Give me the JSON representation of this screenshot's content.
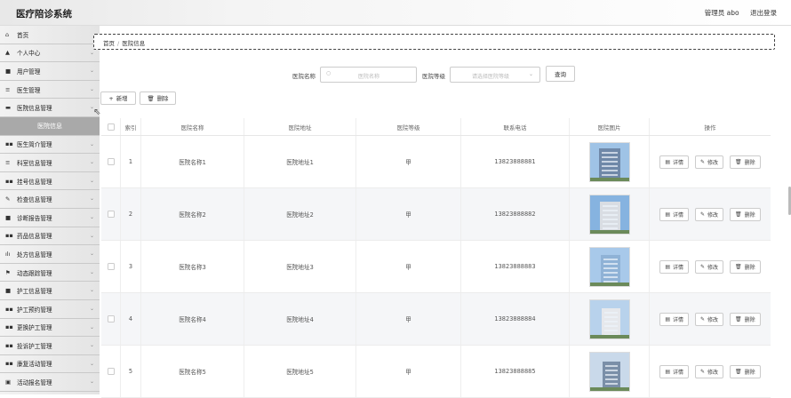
{
  "header": {
    "app_title": "医疗陪诊系统",
    "user_label": "管理员 abo",
    "logout": "退出登录"
  },
  "sidebar": {
    "items": [
      {
        "icon": "home-icon",
        "glyph": "⌂",
        "label": "首页",
        "chevron": false
      },
      {
        "icon": "user-icon",
        "glyph": "▲",
        "label": "个人中心",
        "chevron": true
      },
      {
        "icon": "users-icon",
        "glyph": "■",
        "label": "用户管理",
        "chevron": true
      },
      {
        "icon": "list-icon",
        "glyph": "≡",
        "label": "医生管理",
        "chevron": true
      },
      {
        "icon": "hospital-icon",
        "glyph": "▬",
        "label": "医院信息管理",
        "chevron": true
      },
      {
        "icon": "",
        "glyph": "",
        "label": "医院信息",
        "chevron": false,
        "sub": true
      },
      {
        "icon": "grid-icon",
        "glyph": "▪▪",
        "label": "医生简介管理",
        "chevron": true
      },
      {
        "icon": "list-icon",
        "glyph": "≡",
        "label": "科室信息管理",
        "chevron": true
      },
      {
        "icon": "grid-icon",
        "glyph": "▪▪",
        "label": "挂号信息管理",
        "chevron": true
      },
      {
        "icon": "pen-icon",
        "glyph": "✎",
        "label": "检查信息管理",
        "chevron": true
      },
      {
        "icon": "report-icon",
        "glyph": "■",
        "label": "诊断报告管理",
        "chevron": true
      },
      {
        "icon": "grid-icon",
        "glyph": "▪▪",
        "label": "药品信息管理",
        "chevron": true
      },
      {
        "icon": "chart-icon",
        "glyph": "ılı",
        "label": "处方信息管理",
        "chevron": true
      },
      {
        "icon": "flag-icon",
        "glyph": "⚑",
        "label": "动态跟踪管理",
        "chevron": true
      },
      {
        "icon": "doc-icon",
        "glyph": "■",
        "label": "护工信息管理",
        "chevron": true
      },
      {
        "icon": "grid-icon",
        "glyph": "▪▪",
        "label": "护工预约管理",
        "chevron": true
      },
      {
        "icon": "grid-icon",
        "glyph": "▪▪",
        "label": "更换护工管理",
        "chevron": true
      },
      {
        "icon": "grid-icon",
        "glyph": "▪▪",
        "label": "投诉护工管理",
        "chevron": true
      },
      {
        "icon": "grid-icon",
        "glyph": "▪▪",
        "label": "康复活动管理",
        "chevron": true
      },
      {
        "icon": "ticket-icon",
        "glyph": "▣",
        "label": "活动报名管理",
        "chevron": true
      }
    ]
  },
  "breadcrumb": {
    "home": "首页",
    "sep": "/",
    "current": "医院信息"
  },
  "search": {
    "name_label": "医院名称",
    "name_placeholder": "医院名称",
    "level_label": "医院等级",
    "level_placeholder": "请选择医院等级",
    "query_button": "查询"
  },
  "actions": {
    "add": "新增",
    "delete": "删除"
  },
  "table": {
    "headers": [
      "索引",
      "医院名称",
      "医院地址",
      "医院等级",
      "联系电话",
      "医院图片",
      "操作"
    ],
    "rows": [
      {
        "index": "1",
        "name": "医院名称1",
        "address": "医院地址1",
        "level": "甲",
        "phone": "13823888881"
      },
      {
        "index": "2",
        "name": "医院名称2",
        "address": "医院地址2",
        "level": "甲",
        "phone": "13823888882"
      },
      {
        "index": "3",
        "name": "医院名称3",
        "address": "医院地址3",
        "level": "甲",
        "phone": "13823888883"
      },
      {
        "index": "4",
        "name": "医院名称4",
        "address": "医院地址4",
        "level": "甲",
        "phone": "13823888884"
      },
      {
        "index": "5",
        "name": "医院名称5",
        "address": "医院地址5",
        "level": "甲",
        "phone": "13823888885"
      }
    ],
    "op_detail": "详情",
    "op_edit": "修改",
    "op_delete": "删除"
  }
}
